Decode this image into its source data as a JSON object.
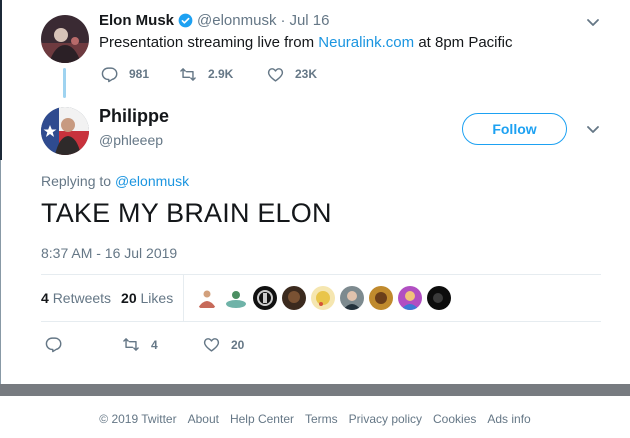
{
  "parent_tweet": {
    "author_name": "Elon Musk",
    "handle": "@elonmusk",
    "separator": "·",
    "date": "Jul 16",
    "text_before": "Presentation streaming live from",
    "text_link": "Neuralink.com",
    "text_after": "at 8pm Pacific",
    "replies": "981",
    "retweets": "2.9K",
    "likes": "23K"
  },
  "tweet": {
    "author_name": "Philippe",
    "handle": "@phleeep",
    "follow_label": "Follow",
    "replying_prefix": "Replying to",
    "replying_handle": "@elonmusk",
    "text": "TAKE MY BRAIN ELON",
    "timestamp": "8:37 AM - 16 Jul 2019",
    "retweets_count": "4",
    "retweets_label": "Retweets",
    "likes_count": "20",
    "likes_label": "Likes",
    "action_retweets": "4",
    "action_likes": "20"
  },
  "footer": {
    "copyright": "© 2019 Twitter",
    "links": [
      "About",
      "Help Center",
      "Terms",
      "Privacy policy",
      "Cookies",
      "Ads info"
    ]
  },
  "colors": {
    "accent": "#1da1f2",
    "link": "#1b95e0",
    "muted": "#657786",
    "thread_line": "#9fd3f0"
  },
  "icons": {
    "verified": "verified-badge-icon",
    "reply": "reply-icon",
    "retweet": "retweet-icon",
    "like": "heart-icon",
    "menu": "chevron-down-icon"
  }
}
